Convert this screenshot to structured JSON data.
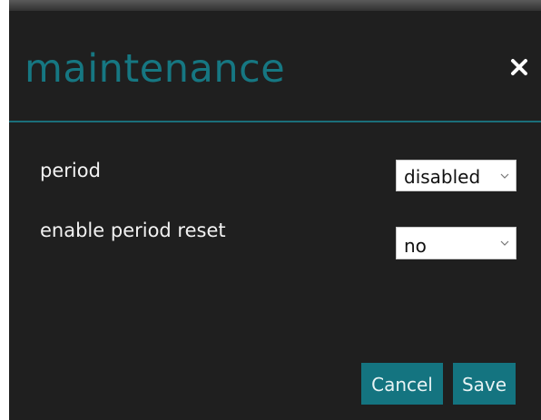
{
  "dialog": {
    "title": "maintenance",
    "close_icon": "close-icon"
  },
  "fields": [
    {
      "label": "period",
      "value": "disabled"
    },
    {
      "label": "enable period reset",
      "value": "no"
    }
  ],
  "buttons": {
    "cancel_label": "Cancel",
    "save_label": "Save"
  },
  "colors": {
    "dialog_background": "#1f1f1f",
    "accent": "#167782",
    "button": "#147480",
    "text": "#f2f2f2"
  }
}
